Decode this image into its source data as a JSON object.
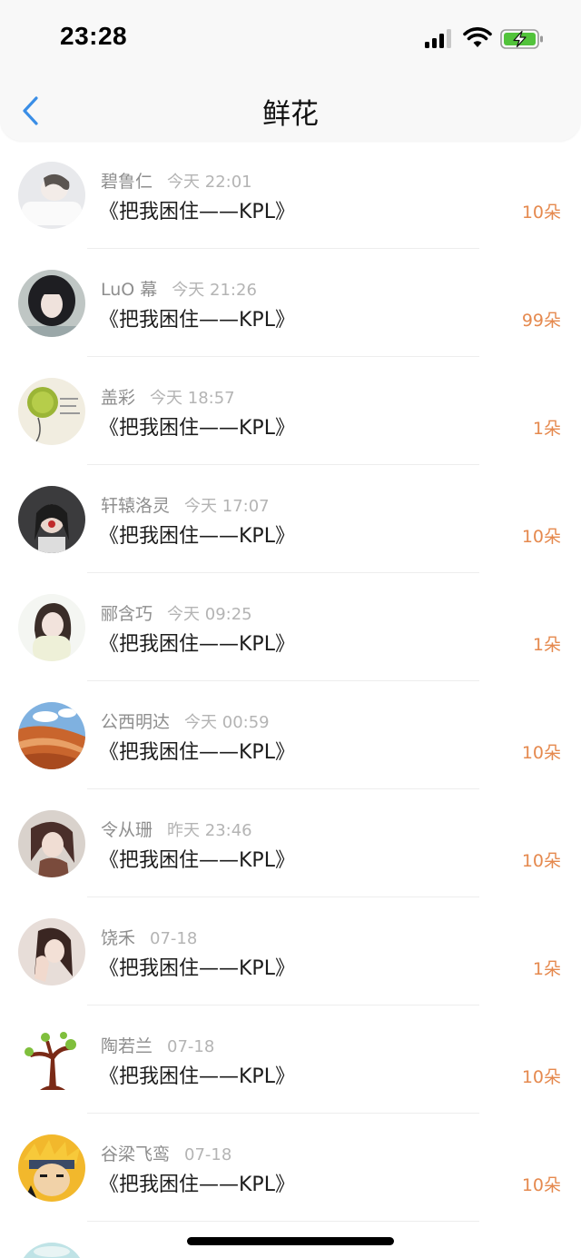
{
  "status_bar": {
    "time": "23:28"
  },
  "nav": {
    "title": "鲜花"
  },
  "colors": {
    "count": "#e5894e",
    "back_arrow": "#3a8ee6"
  },
  "items": [
    {
      "name": "碧鲁仁",
      "time": "今天 22:01",
      "work": "《把我困住——KPL》",
      "count": "10朵"
    },
    {
      "name": "LuO 幕",
      "time": "今天 21:26",
      "work": "《把我困住——KPL》",
      "count": "99朵"
    },
    {
      "name": "盖彩",
      "time": "今天 18:57",
      "work": "《把我困住——KPL》",
      "count": "1朵"
    },
    {
      "name": "轩辕洛灵",
      "time": "今天 17:07",
      "work": "《把我困住——KPL》",
      "count": "10朵"
    },
    {
      "name": "郦含巧",
      "time": "今天 09:25",
      "work": "《把我困住——KPL》",
      "count": "1朵"
    },
    {
      "name": "公西明达",
      "time": "今天 00:59",
      "work": "《把我困住——KPL》",
      "count": "10朵"
    },
    {
      "name": "令从珊",
      "time": "昨天 23:46",
      "work": "《把我困住——KPL》",
      "count": "10朵"
    },
    {
      "name": "饶禾",
      "time": "07-18",
      "work": "《把我困住——KPL》",
      "count": "1朵"
    },
    {
      "name": "陶若兰",
      "time": "07-18",
      "work": "《把我困住——KPL》",
      "count": "10朵"
    },
    {
      "name": "谷梁飞鸾",
      "time": "07-18",
      "work": "《把我困住——KPL》",
      "count": "10朵"
    }
  ]
}
